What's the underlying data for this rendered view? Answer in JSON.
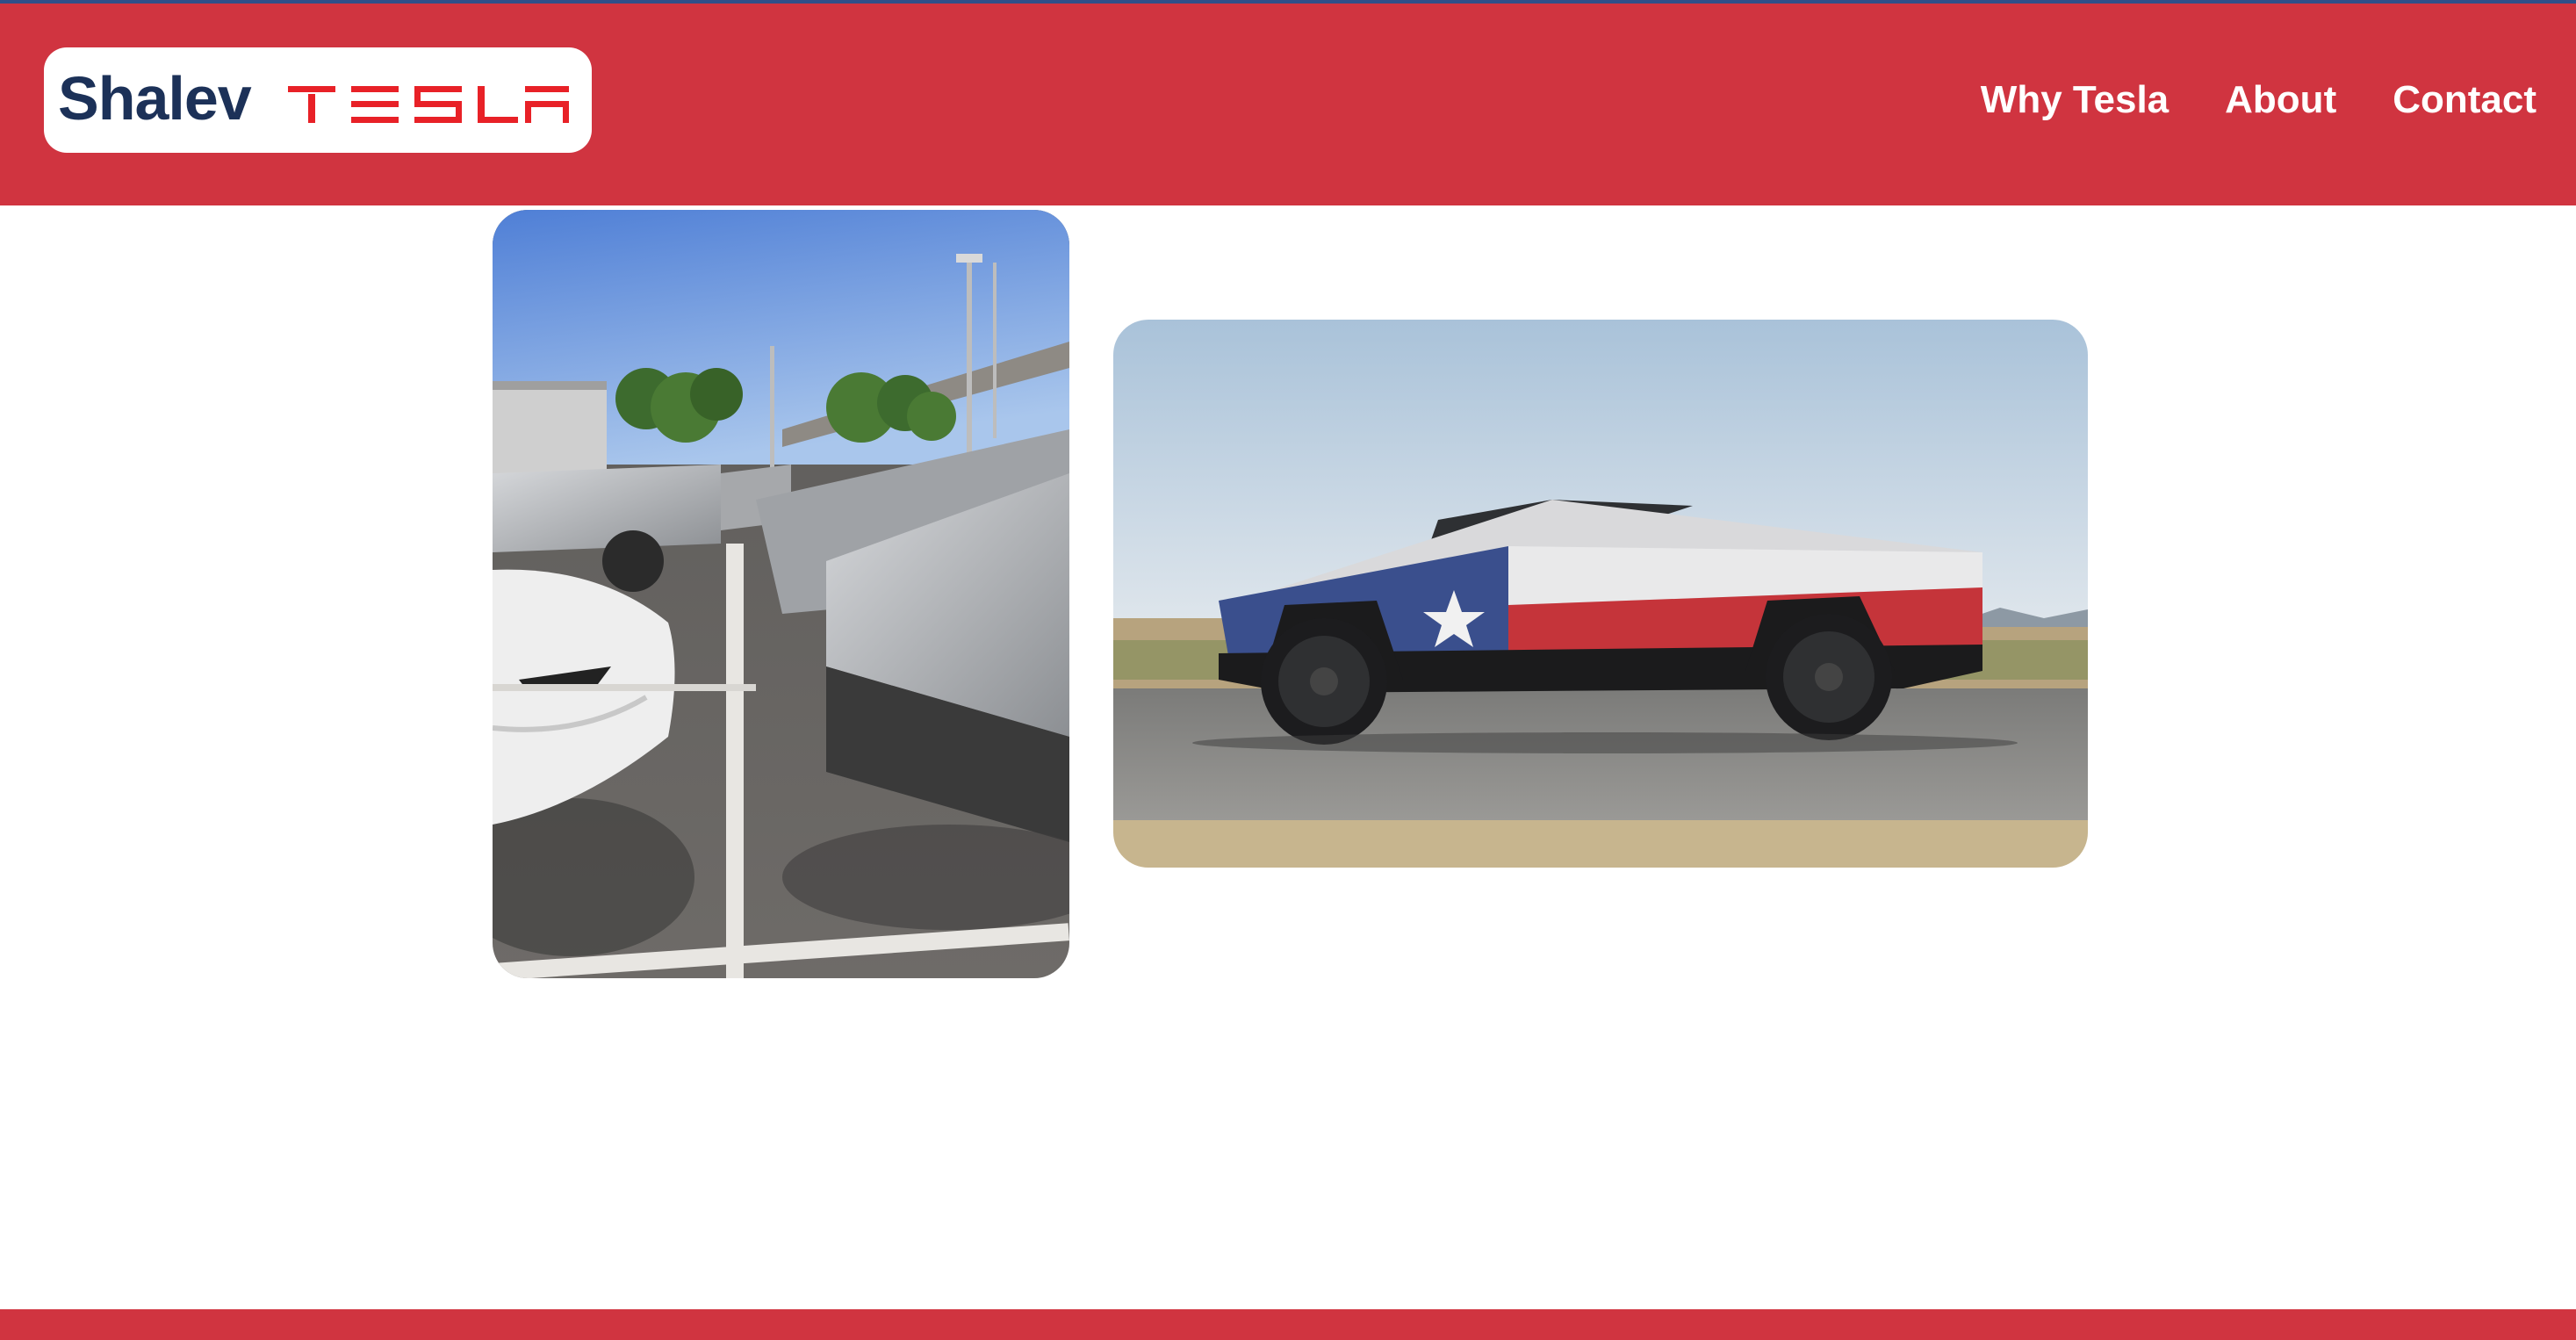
{
  "header": {
    "logo_text": "Shalev",
    "brand_wordmark": "TESLA",
    "brand_color": "#e82127",
    "background_color": "#d03440"
  },
  "nav": {
    "items": [
      {
        "label": "Why Tesla"
      },
      {
        "label": "About"
      },
      {
        "label": "Contact"
      }
    ]
  },
  "gallery": {
    "images": [
      {
        "subject": "parking lot with Cybertrucks and a white Model 3"
      },
      {
        "subject": "Cybertruck wrapped in Texas flag on desert road"
      }
    ]
  },
  "footer": {
    "background_color": "#d03440"
  }
}
